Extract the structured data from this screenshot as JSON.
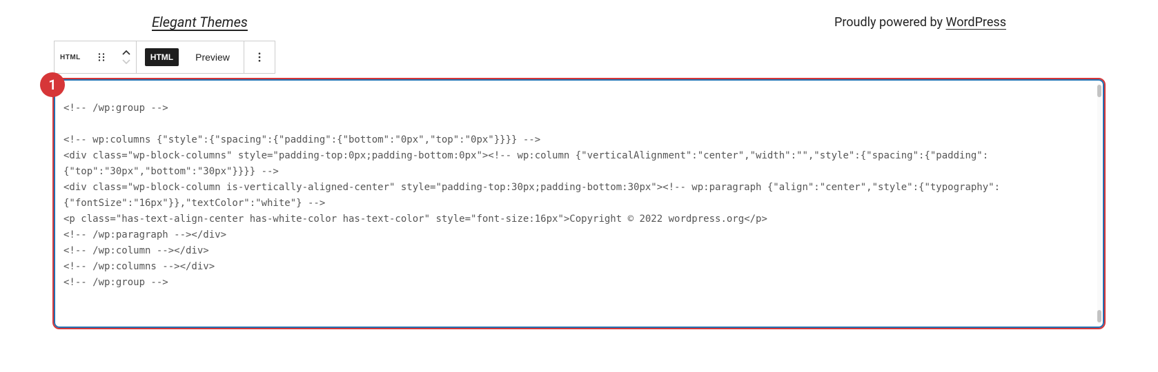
{
  "header": {
    "site_title": "Elegant Themes",
    "powered_by_prefix": "Proudly powered by ",
    "wordpress_link": "WordPress"
  },
  "toolbar": {
    "block_type_label": "HTML",
    "html_tab_label": "HTML",
    "preview_tab_label": "Preview"
  },
  "step": {
    "number": "1"
  },
  "code_lines": {
    "l0": "<!-- /wp:group -->",
    "l1": "",
    "l2": "<!-- wp:columns {\"style\":{\"spacing\":{\"padding\":{\"bottom\":\"0px\",\"top\":\"0px\"}}}} -->",
    "l3": "<div class=\"wp-block-columns\" style=\"padding-top:0px;padding-bottom:0px\"><!-- wp:column {\"verticalAlignment\":\"center\",\"width\":\"\",\"style\":{\"spacing\":{\"padding\":{\"top\":\"30px\",\"bottom\":\"30px\"}}}} -->",
    "l4": "<div class=\"wp-block-column is-vertically-aligned-center\" style=\"padding-top:30px;padding-bottom:30px\"><!-- wp:paragraph {\"align\":\"center\",\"style\":{\"typography\":{\"fontSize\":\"16px\"}},\"textColor\":\"white\"} -->",
    "l5": "<p class=\"has-text-align-center has-white-color has-text-color\" style=\"font-size:16px\">Copyright © 2022 wordpress.org</p>",
    "l6": "<!-- /wp:paragraph --></div>",
    "l7": "<!-- /wp:column --></div>",
    "l8": "<!-- /wp:columns --></div>",
    "l9": "<!-- /wp:group -->"
  }
}
